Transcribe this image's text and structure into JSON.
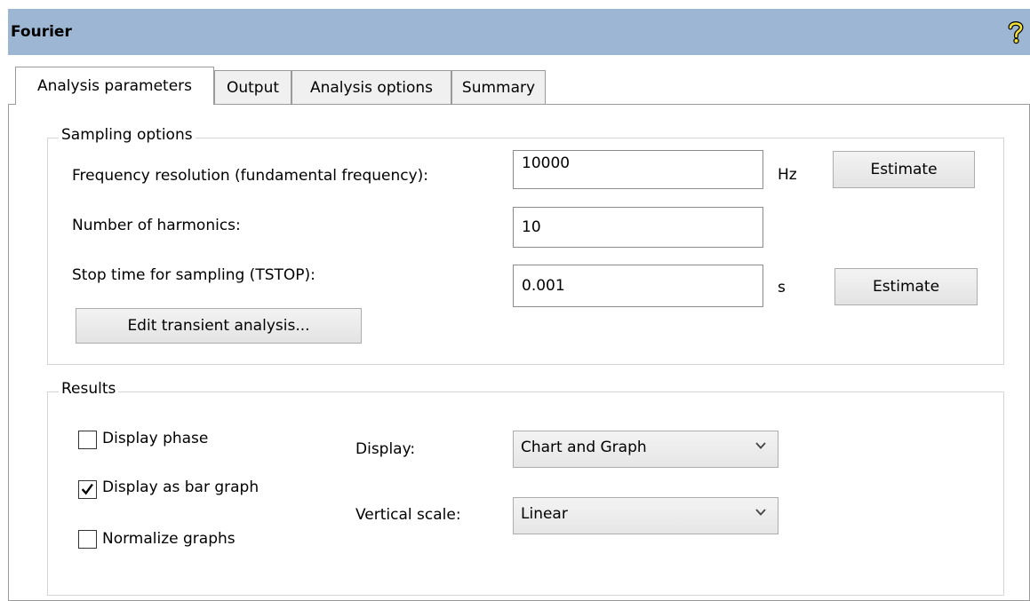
{
  "window": {
    "title": "Fourier",
    "help_icon": "help-question-icon"
  },
  "tabs": [
    {
      "label": "Analysis parameters",
      "active": true
    },
    {
      "label": "Output",
      "active": false
    },
    {
      "label": "Analysis options",
      "active": false
    },
    {
      "label": "Summary",
      "active": false
    }
  ],
  "sampling": {
    "group_label": "Sampling options",
    "freq_label": "Frequency resolution (fundamental frequency):",
    "freq_value": "10000",
    "freq_unit": "Hz",
    "freq_estimate": "Estimate",
    "harmonics_label": "Number of harmonics:",
    "harmonics_value": "10",
    "tstop_label": "Stop time for sampling (TSTOP):",
    "tstop_value": "0.001",
    "tstop_unit": "s",
    "tstop_estimate": "Estimate",
    "edit_transient": "Edit transient analysis..."
  },
  "results": {
    "group_label": "Results",
    "display_phase": {
      "label": "Display phase",
      "checked": false
    },
    "bar_graph": {
      "label": "Display as bar graph",
      "checked": true
    },
    "normalize": {
      "label": "Normalize graphs",
      "checked": false
    },
    "display_label": "Display:",
    "display_value": "Chart and Graph",
    "vscale_label": "Vertical scale:",
    "vscale_value": "Linear"
  }
}
